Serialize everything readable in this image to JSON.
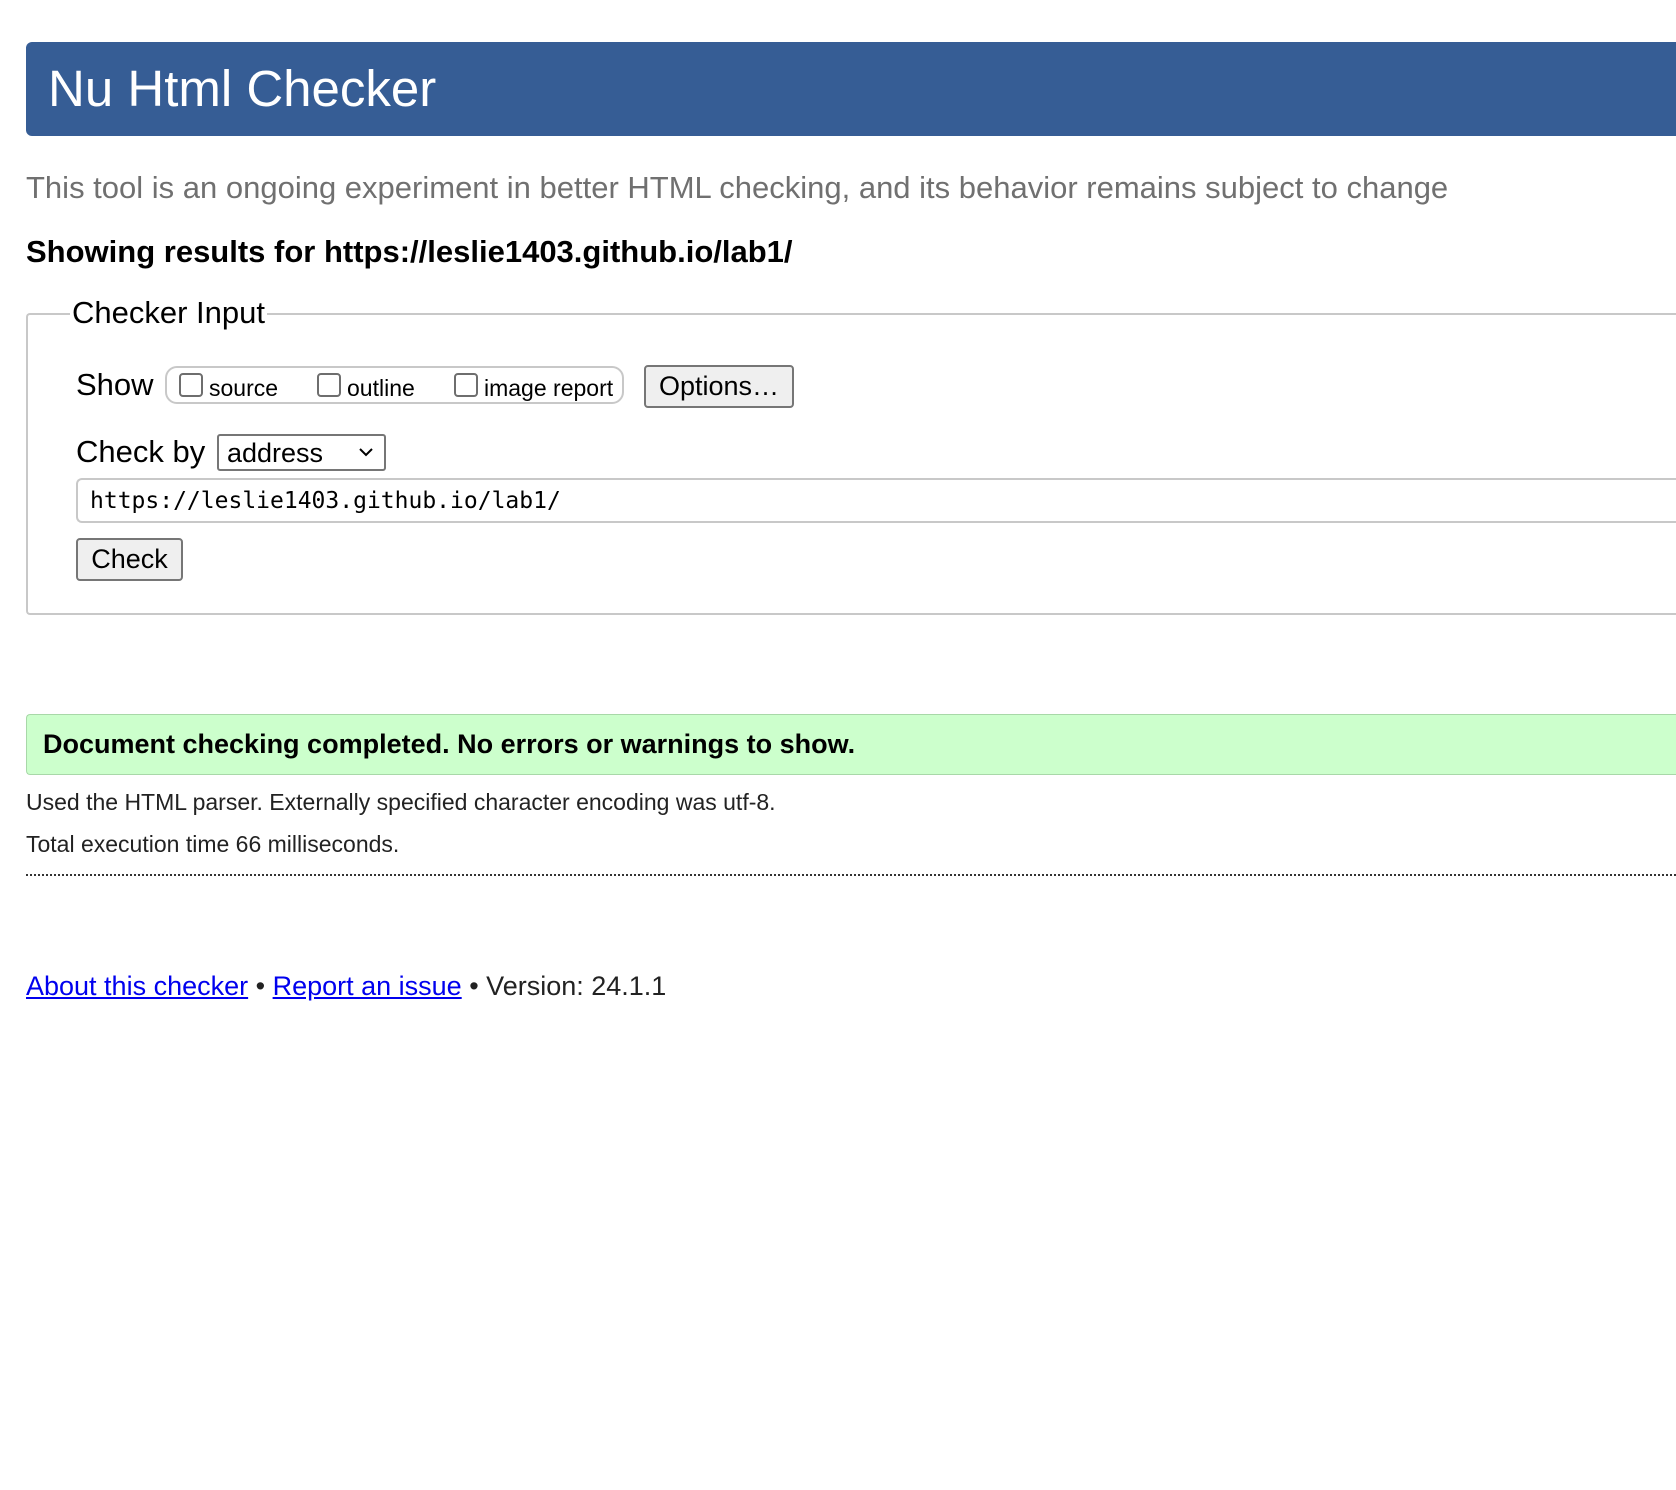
{
  "header": {
    "title": "Nu Html Checker"
  },
  "intro": "This tool is an ongoing experiment in better HTML checking, and its behavior remains subject to change",
  "results_heading": "Showing results for https://leslie1403.github.io/lab1/",
  "checker_input": {
    "legend": "Checker Input",
    "show_label": "Show",
    "checkboxes": [
      {
        "label": "source",
        "checked": false
      },
      {
        "label": "outline",
        "checked": false
      },
      {
        "label": "image report",
        "checked": false
      }
    ],
    "options_label": "Options…",
    "check_by_label": "Check by",
    "check_by_value": "address",
    "url_value": "https://leslie1403.github.io/lab1/",
    "check_label": "Check"
  },
  "result": {
    "status": "Document checking completed. No errors or warnings to show.",
    "parser_info": "Used the HTML parser. Externally specified character encoding was utf-8.",
    "execution_time": "Total execution time 66 milliseconds."
  },
  "footer": {
    "about_link": "About this checker",
    "separator": " • ",
    "report_link": "Report an issue",
    "version": "Version: 24.1.1"
  },
  "colors": {
    "header_bg": "#365d95",
    "success_bg": "#ccffcc",
    "link": "#0000ee"
  }
}
